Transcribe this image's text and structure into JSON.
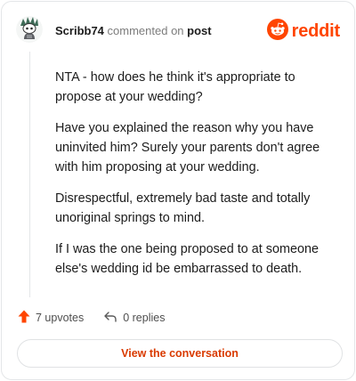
{
  "header": {
    "username": "Scribb74",
    "commented_text": "commented on",
    "post_link": "post",
    "brand": "reddit"
  },
  "comment": {
    "paragraphs": [
      "NTA - how does he think it's appropriate to propose at your wedding?",
      "Have you explained the reason why you have uninvited him? Surely your parents don't agree with him proposing at your wedding.",
      "Disrespectful, extremely bad taste and totally unoriginal springs to mind.",
      "If I was the one being proposed to at someone else's wedding id be embarrassed to death."
    ]
  },
  "actions": {
    "upvotes": "7 upvotes",
    "replies": "0 replies"
  },
  "cta": {
    "label": "View the conversation"
  },
  "colors": {
    "brand": "#ff4500",
    "cta_text": "#d93a00"
  },
  "icons": {
    "upvote": "upvote-arrow-icon",
    "reply": "reply-arrow-icon",
    "brand": "reddit-alien-icon",
    "avatar": "snoo-avatar"
  }
}
